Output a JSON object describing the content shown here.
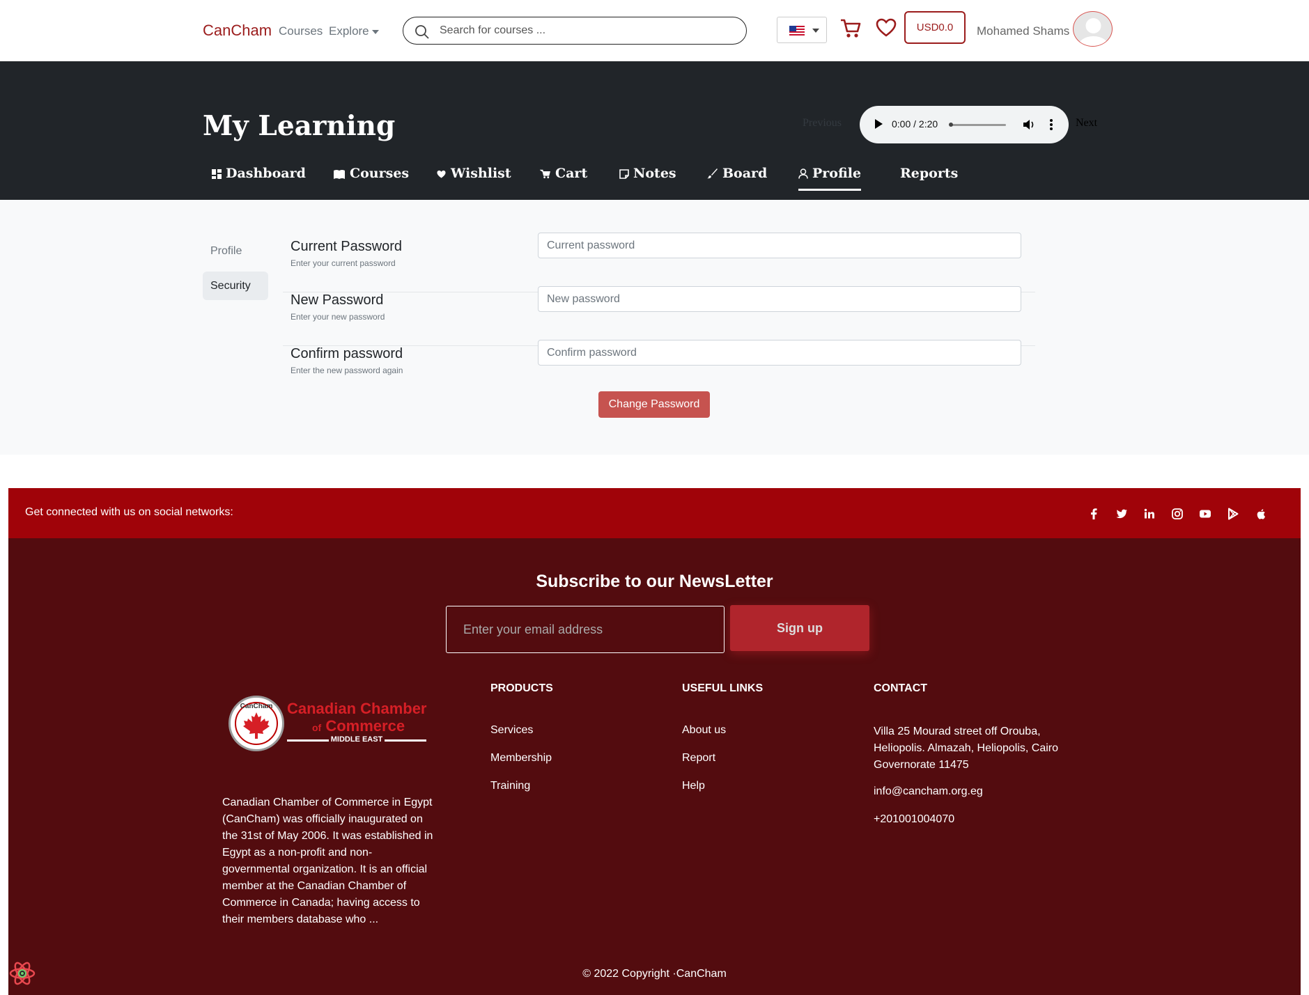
{
  "navbar": {
    "brand": "CanCham",
    "links": {
      "courses": "Courses",
      "explore": "Explore"
    },
    "search_placeholder": "Search for courses ...",
    "balance": "USD0.0",
    "username": "Mohamed Shams"
  },
  "hero": {
    "title": "My Learning",
    "previous": "Previous",
    "next": "Next",
    "audio_time": "0:00 / 2:20",
    "tabs": [
      "Dashboard",
      "Courses",
      "Wishlist",
      "Cart",
      "Notes",
      "Board",
      "Profile",
      "Reports"
    ],
    "active_tab": "Profile"
  },
  "sidebar": {
    "items": [
      "Profile",
      "Security"
    ],
    "active": "Security"
  },
  "form": {
    "fields": [
      {
        "label": "Current Password",
        "help": "Enter your current password",
        "placeholder": "Current password"
      },
      {
        "label": "New Password",
        "help": "Enter your new password",
        "placeholder": "New password"
      },
      {
        "label": "Confirm password",
        "help": "Enter the new password again",
        "placeholder": "Confirm password"
      }
    ],
    "submit": "Change Password"
  },
  "footer": {
    "social_text": "Get connected with us on social networks:",
    "social_icons": [
      "facebook-icon",
      "twitter-icon",
      "linkedin-icon",
      "instagram-icon",
      "youtube-icon",
      "google-play-icon",
      "apple-icon"
    ],
    "newsletter_title": "Subscribe to our NewsLetter",
    "email_placeholder": "Enter your email address",
    "signup": "Sign up",
    "logo": {
      "line1": "Canadian Chamber",
      "line2_prefix": "of",
      "line2": "Commerce",
      "line3": "MIDDLE EAST",
      "seal": "CanCham"
    },
    "about": "Canadian Chamber of Commerce in Egypt (CanCham) was officially inaugurated on the 31st of May 2006. It was established in Egypt as a non-profit and non-governmental organization. It is an official member at the Canadian Chamber of Commerce in Canada; having access to their members database who ...",
    "products": {
      "title": "PRODUCTS",
      "links": [
        "Services",
        "Membership",
        "Training"
      ]
    },
    "useful_links": {
      "title": "USEFUL LINKS",
      "links": [
        "About us",
        "Report",
        "Help"
      ]
    },
    "contact": {
      "title": "CONTACT",
      "address": "Villa 25 Mourad street off Orouba, Heliopolis. Almazah, Heliopolis, Cairo Governorate 11475",
      "email": "info@cancham.org.eg",
      "phone": "+201001004070"
    },
    "copyright": "© 2022 Copyright ·CanCham"
  },
  "colors": {
    "brand": "#9b1c1c",
    "social_bar": "#a00309",
    "footer_bg": "#530c0f",
    "button": "#c6534f"
  }
}
